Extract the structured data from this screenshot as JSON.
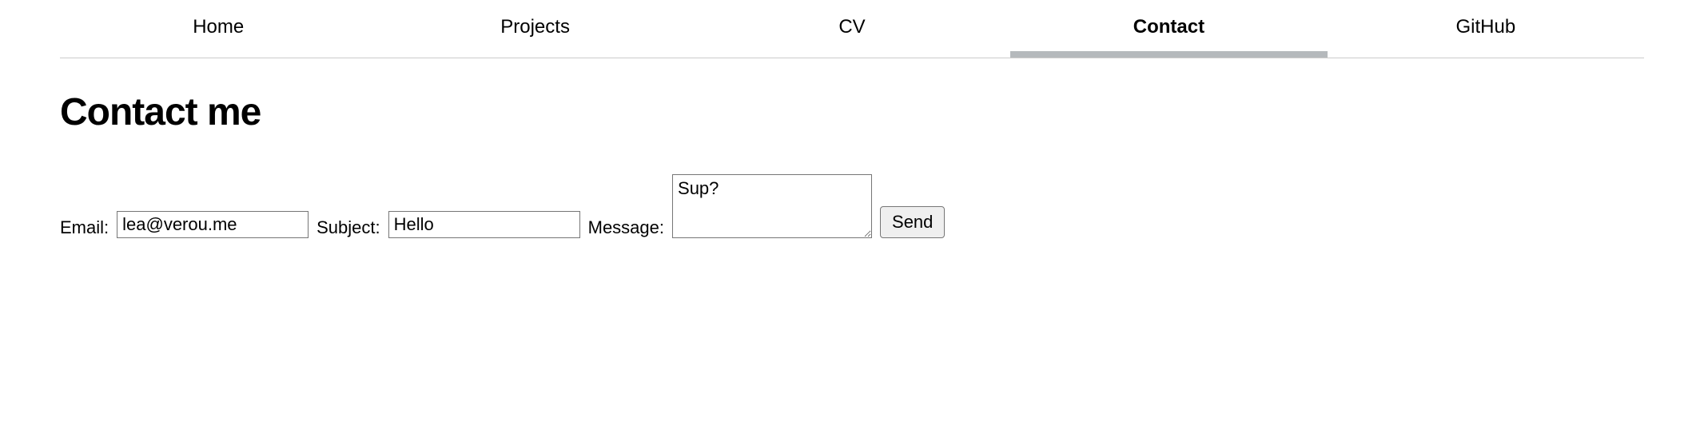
{
  "nav": {
    "items": [
      {
        "label": "Home"
      },
      {
        "label": "Projects"
      },
      {
        "label": "CV"
      },
      {
        "label": "Contact"
      },
      {
        "label": "GitHub"
      }
    ],
    "active_index": 3
  },
  "page": {
    "heading": "Contact me"
  },
  "form": {
    "email_label": "Email:",
    "email_value": "lea@verou.me",
    "subject_label": "Subject:",
    "subject_value": "Hello",
    "message_label": "Message:",
    "message_value": "Sup?",
    "submit_label": "Send"
  }
}
